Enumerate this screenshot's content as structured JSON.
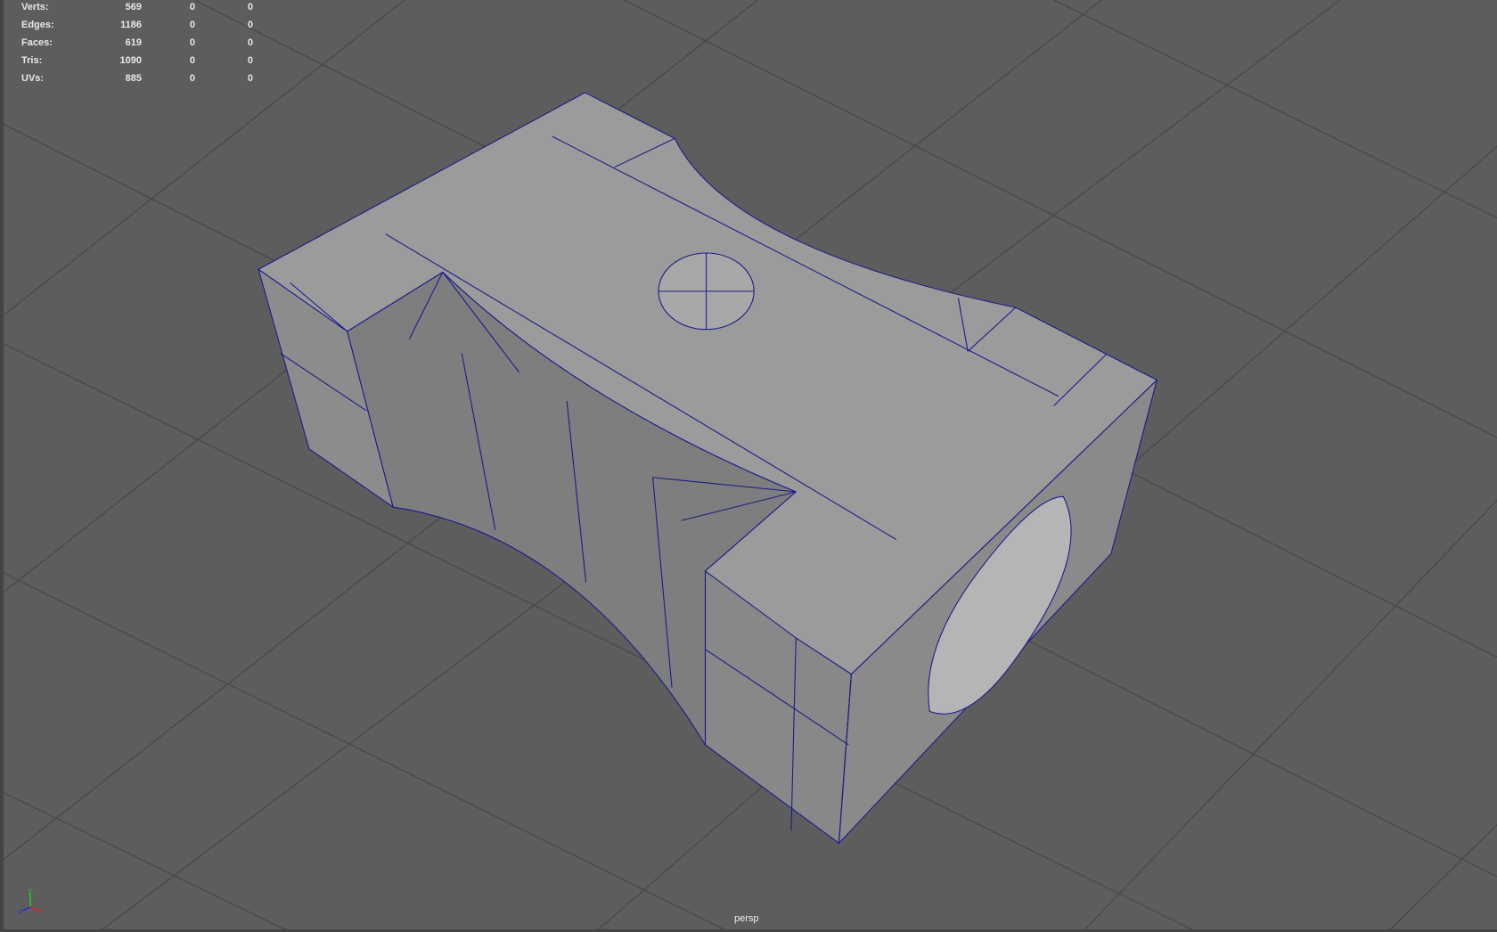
{
  "hud": {
    "rows": [
      {
        "label": "Verts:",
        "values": [
          "569",
          "0",
          "0"
        ]
      },
      {
        "label": "Edges:",
        "values": [
          "1186",
          "0",
          "0"
        ]
      },
      {
        "label": "Faces:",
        "values": [
          "619",
          "0",
          "0"
        ]
      },
      {
        "label": "Tris:",
        "values": [
          "1090",
          "0",
          "0"
        ]
      },
      {
        "label": "UVs:",
        "values": [
          "885",
          "0",
          "0"
        ]
      }
    ]
  },
  "camera": {
    "name": "persp"
  },
  "axis": {
    "x": "x",
    "y": "y",
    "z": "z"
  },
  "colors": {
    "background": "#5d5d5d",
    "grid": "#4a4a4a",
    "wire": "#1a1a8c",
    "model": "#9a9a9a"
  }
}
